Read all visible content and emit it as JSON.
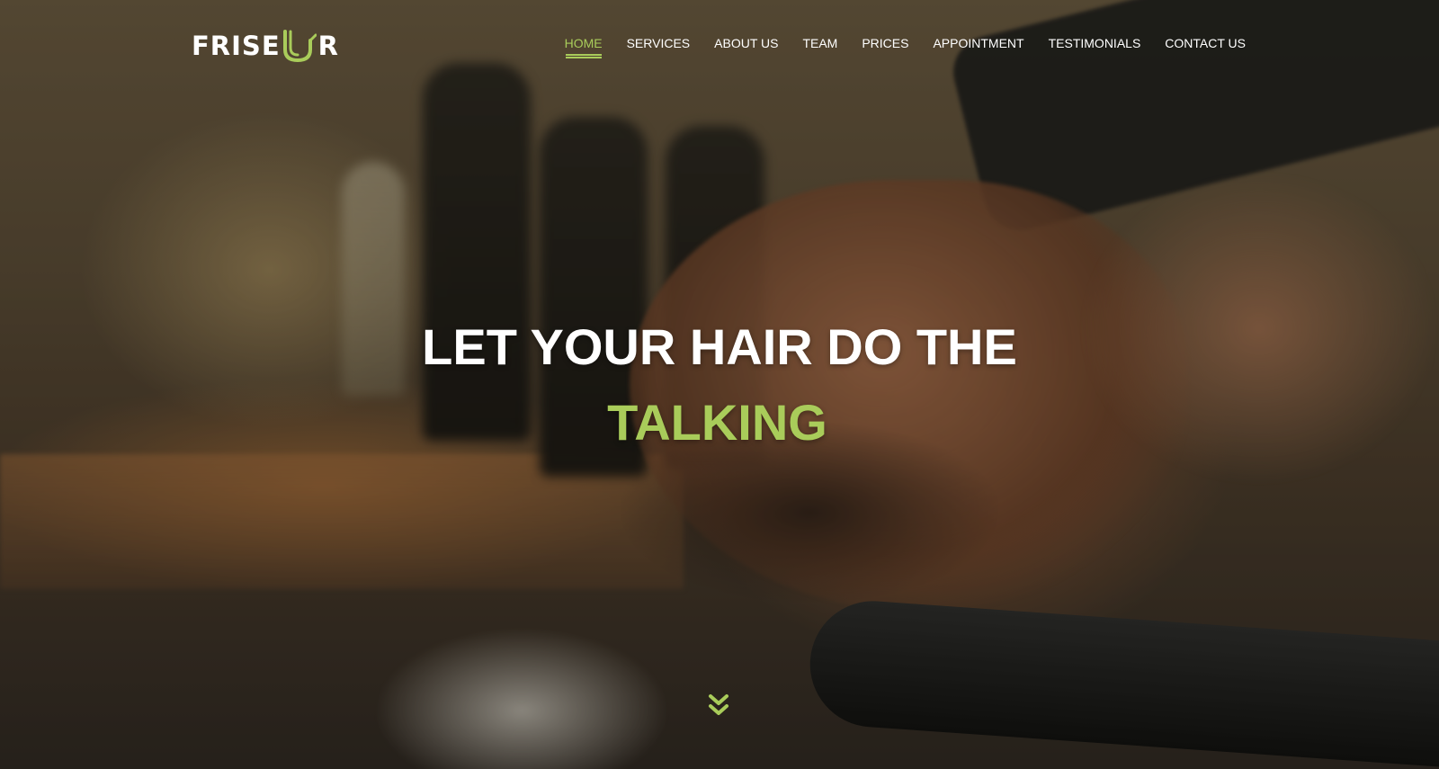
{
  "brand": {
    "logo_text_left": "FRISE",
    "logo_text_right": "R",
    "logo_accent_color": "#a9cc5a"
  },
  "nav": {
    "items": [
      {
        "label": "HOME",
        "active": true
      },
      {
        "label": "SERVICES",
        "active": false
      },
      {
        "label": "ABOUT US",
        "active": false
      },
      {
        "label": "TEAM",
        "active": false
      },
      {
        "label": "PRICES",
        "active": false
      },
      {
        "label": "APPOINTMENT",
        "active": false
      },
      {
        "label": "TESTIMONIALS",
        "active": false
      },
      {
        "label": "CONTACT US",
        "active": false
      }
    ]
  },
  "hero": {
    "headline_line1": "LET YOUR HAIR DO THE",
    "headline_line2": "TALKING",
    "accent_color": "#a9cc5a",
    "background_image": "barber washing bearded man's hair",
    "scroll_icon": "double-chevron-down-icon"
  }
}
